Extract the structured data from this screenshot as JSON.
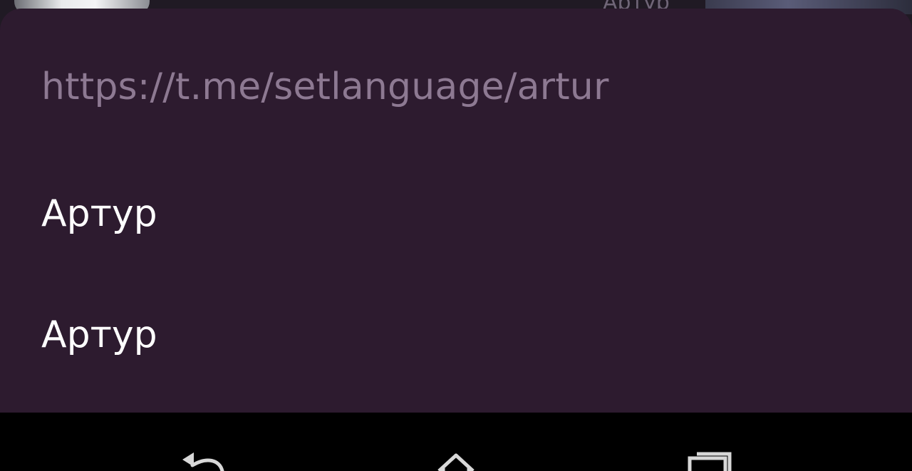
{
  "background": {
    "peek_label": "Артур"
  },
  "sheet": {
    "url": "https://t.me/setlanguage/artur",
    "items": [
      {
        "label": "Артур"
      },
      {
        "label": "Артур"
      }
    ]
  },
  "navbar": {
    "buttons": [
      {
        "icon": "back-icon"
      },
      {
        "icon": "home-icon"
      },
      {
        "icon": "recents-icon"
      }
    ]
  },
  "colors": {
    "sheet_bg": "#2d1b2f",
    "url_text": "#8d7992",
    "item_text": "#ffffff",
    "navbar_bg": "#000000"
  }
}
